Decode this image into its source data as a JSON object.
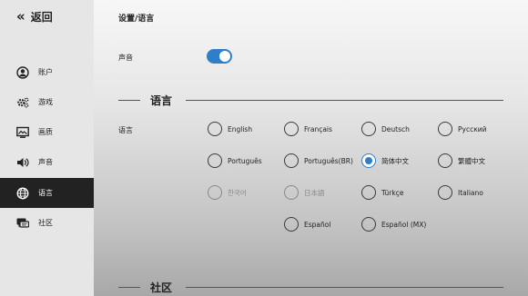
{
  "back_label": "返回",
  "nav": [
    {
      "label": "账户",
      "icon": "user-icon"
    },
    {
      "label": "游戏",
      "icon": "gears-icon"
    },
    {
      "label": "画质",
      "icon": "display-icon"
    },
    {
      "label": "声音",
      "icon": "speaker-icon"
    },
    {
      "label": "语言",
      "icon": "globe-icon",
      "active": true
    },
    {
      "label": "社区",
      "icon": "chat-icon"
    }
  ],
  "page_title": "设置/语言",
  "sound": {
    "label": "声音",
    "enabled": true
  },
  "sections": {
    "language": "语言",
    "community": "社区"
  },
  "language_label": "语言",
  "languages": [
    {
      "label": "English",
      "selected": false,
      "muted": false
    },
    {
      "label": "Français",
      "selected": false,
      "muted": false
    },
    {
      "label": "Deutsch",
      "selected": false,
      "muted": false
    },
    {
      "label": "Русский",
      "selected": false,
      "muted": false
    },
    {
      "label": "Português",
      "selected": false,
      "muted": false
    },
    {
      "label": "Português(BR)",
      "selected": false,
      "muted": false
    },
    {
      "label": "简体中文",
      "selected": true,
      "muted": false
    },
    {
      "label": "繁體中文",
      "selected": false,
      "muted": false
    },
    {
      "label": "한국어",
      "selected": false,
      "muted": true
    },
    {
      "label": "日本語",
      "selected": false,
      "muted": true
    },
    {
      "label": "Türkçe",
      "selected": false,
      "muted": false
    },
    {
      "label": "Italiano",
      "selected": false,
      "muted": false
    },
    {
      "label": "Español",
      "selected": false,
      "muted": false
    },
    {
      "label": "Español (MX)",
      "selected": false,
      "muted": false
    }
  ],
  "colors": {
    "accent": "#2e7ec9",
    "active_nav": "#222222"
  }
}
